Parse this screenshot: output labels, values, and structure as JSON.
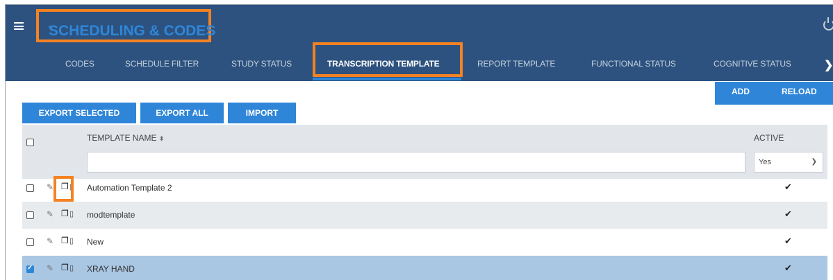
{
  "header": {
    "app_title": "SCHEDULING & CODES",
    "app_title_caret": "▾",
    "tabs": [
      {
        "label": "CODES",
        "active": false
      },
      {
        "label": "SCHEDULE FILTER",
        "active": false
      },
      {
        "label": "STUDY STATUS",
        "active": false
      },
      {
        "label": "TRANSCRIPTION TEMPLATE",
        "active": true
      },
      {
        "label": "REPORT TEMPLATE",
        "active": false
      },
      {
        "label": "FUNCTIONAL STATUS",
        "active": false
      },
      {
        "label": "COGNITIVE STATUS",
        "active": false
      }
    ],
    "next_arrow": "❯"
  },
  "toolbar": {
    "add_label": "ADD",
    "reload_label": "RELOAD",
    "export_selected_label": "EXPORT SELECTED",
    "export_all_label": "EXPORT ALL",
    "import_label": "IMPORT"
  },
  "grid": {
    "columns": {
      "template_name": "TEMPLATE NAME",
      "active": "ACTIVE"
    },
    "filters": {
      "template_name_value": "",
      "active_value": "Yes"
    },
    "rows": [
      {
        "name": "Automation Template 2",
        "active": true,
        "selected": false
      },
      {
        "name": "modtemplate",
        "active": true,
        "selected": false
      },
      {
        "name": "New",
        "active": true,
        "selected": false
      },
      {
        "name": "XRAY HAND",
        "active": true,
        "selected": true
      }
    ]
  },
  "colors": {
    "header_bg": "#2d527f",
    "accent_blue": "#2f86d8",
    "highlight_orange": "#f58223",
    "selected_row": "#a9c6e3"
  }
}
